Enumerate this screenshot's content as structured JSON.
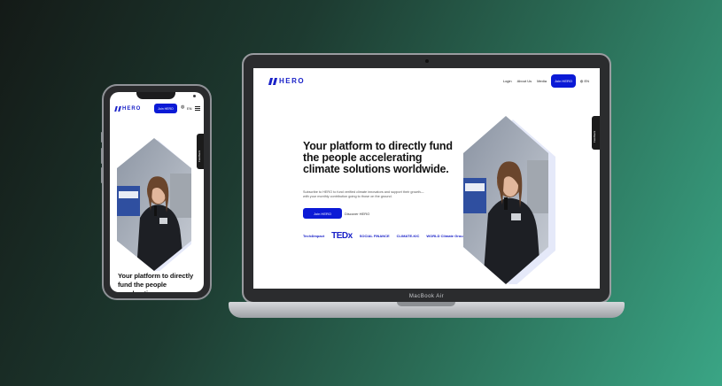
{
  "laptop": {
    "brand": "MacBook Air",
    "nav": {
      "logo": "HERO",
      "links": [
        "Login",
        "About Us",
        "Media"
      ],
      "join_label": "Join HERO",
      "lang": "EN"
    },
    "feedback_label": "Feedback",
    "headline": "Your platform to directly fund the people accelerating climate solutions worldwide.",
    "subtext": "Subscribe to HERO to fund verified climate innovators and support their growth—with your monthly contribution going to those on the ground.",
    "cta_primary": "Join HERO",
    "cta_secondary": "Discover HERO",
    "partners": [
      "Tech4Impact",
      "TEDx",
      "SOCIAL FINANCE",
      "CLIMATE-KIC",
      "WORLD Climate Group"
    ]
  },
  "phone": {
    "logo": "HERO",
    "join_label": "Join HERO",
    "lang": "EN",
    "feedback_label": "Feedback",
    "headline": "Your platform to directly fund the people accelerating"
  },
  "colors": {
    "brand_blue": "#0b1ad6",
    "logo_blue": "#1a22c8"
  }
}
